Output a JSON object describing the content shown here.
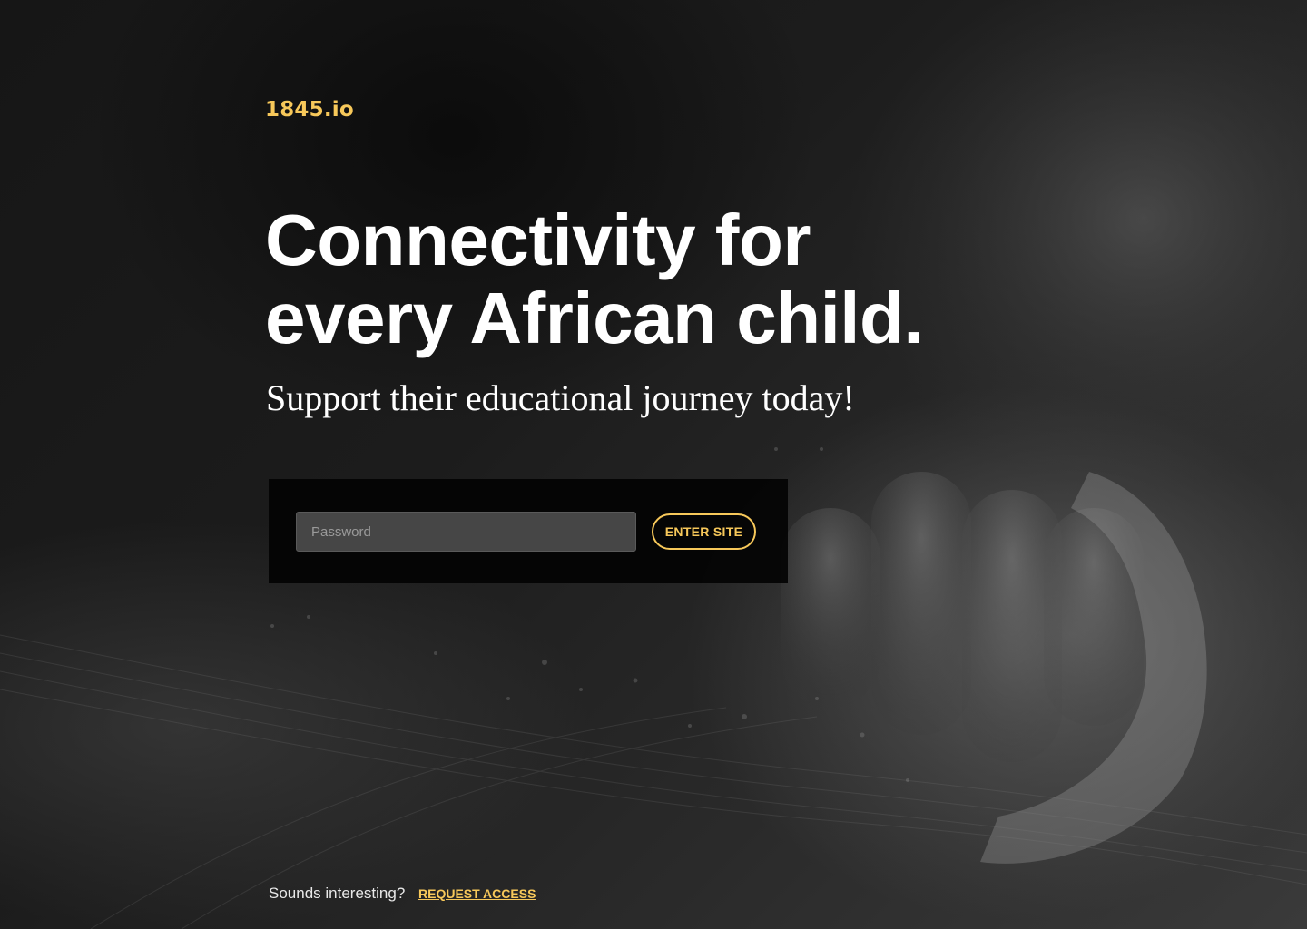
{
  "brand": {
    "logo_text": "1845.io",
    "accent_color": "#f7c85a"
  },
  "hero": {
    "headline": "Connectivity for every African child.",
    "subheadline": "Support their educational journey today!"
  },
  "login_form": {
    "password_placeholder": "Password",
    "password_value": "",
    "submit_label": "ENTER SITE"
  },
  "footer": {
    "prompt_text": "Sounds interesting?",
    "request_access_label": "REQUEST ACCESS"
  },
  "background": {
    "image_description_icon": "background-photo"
  }
}
